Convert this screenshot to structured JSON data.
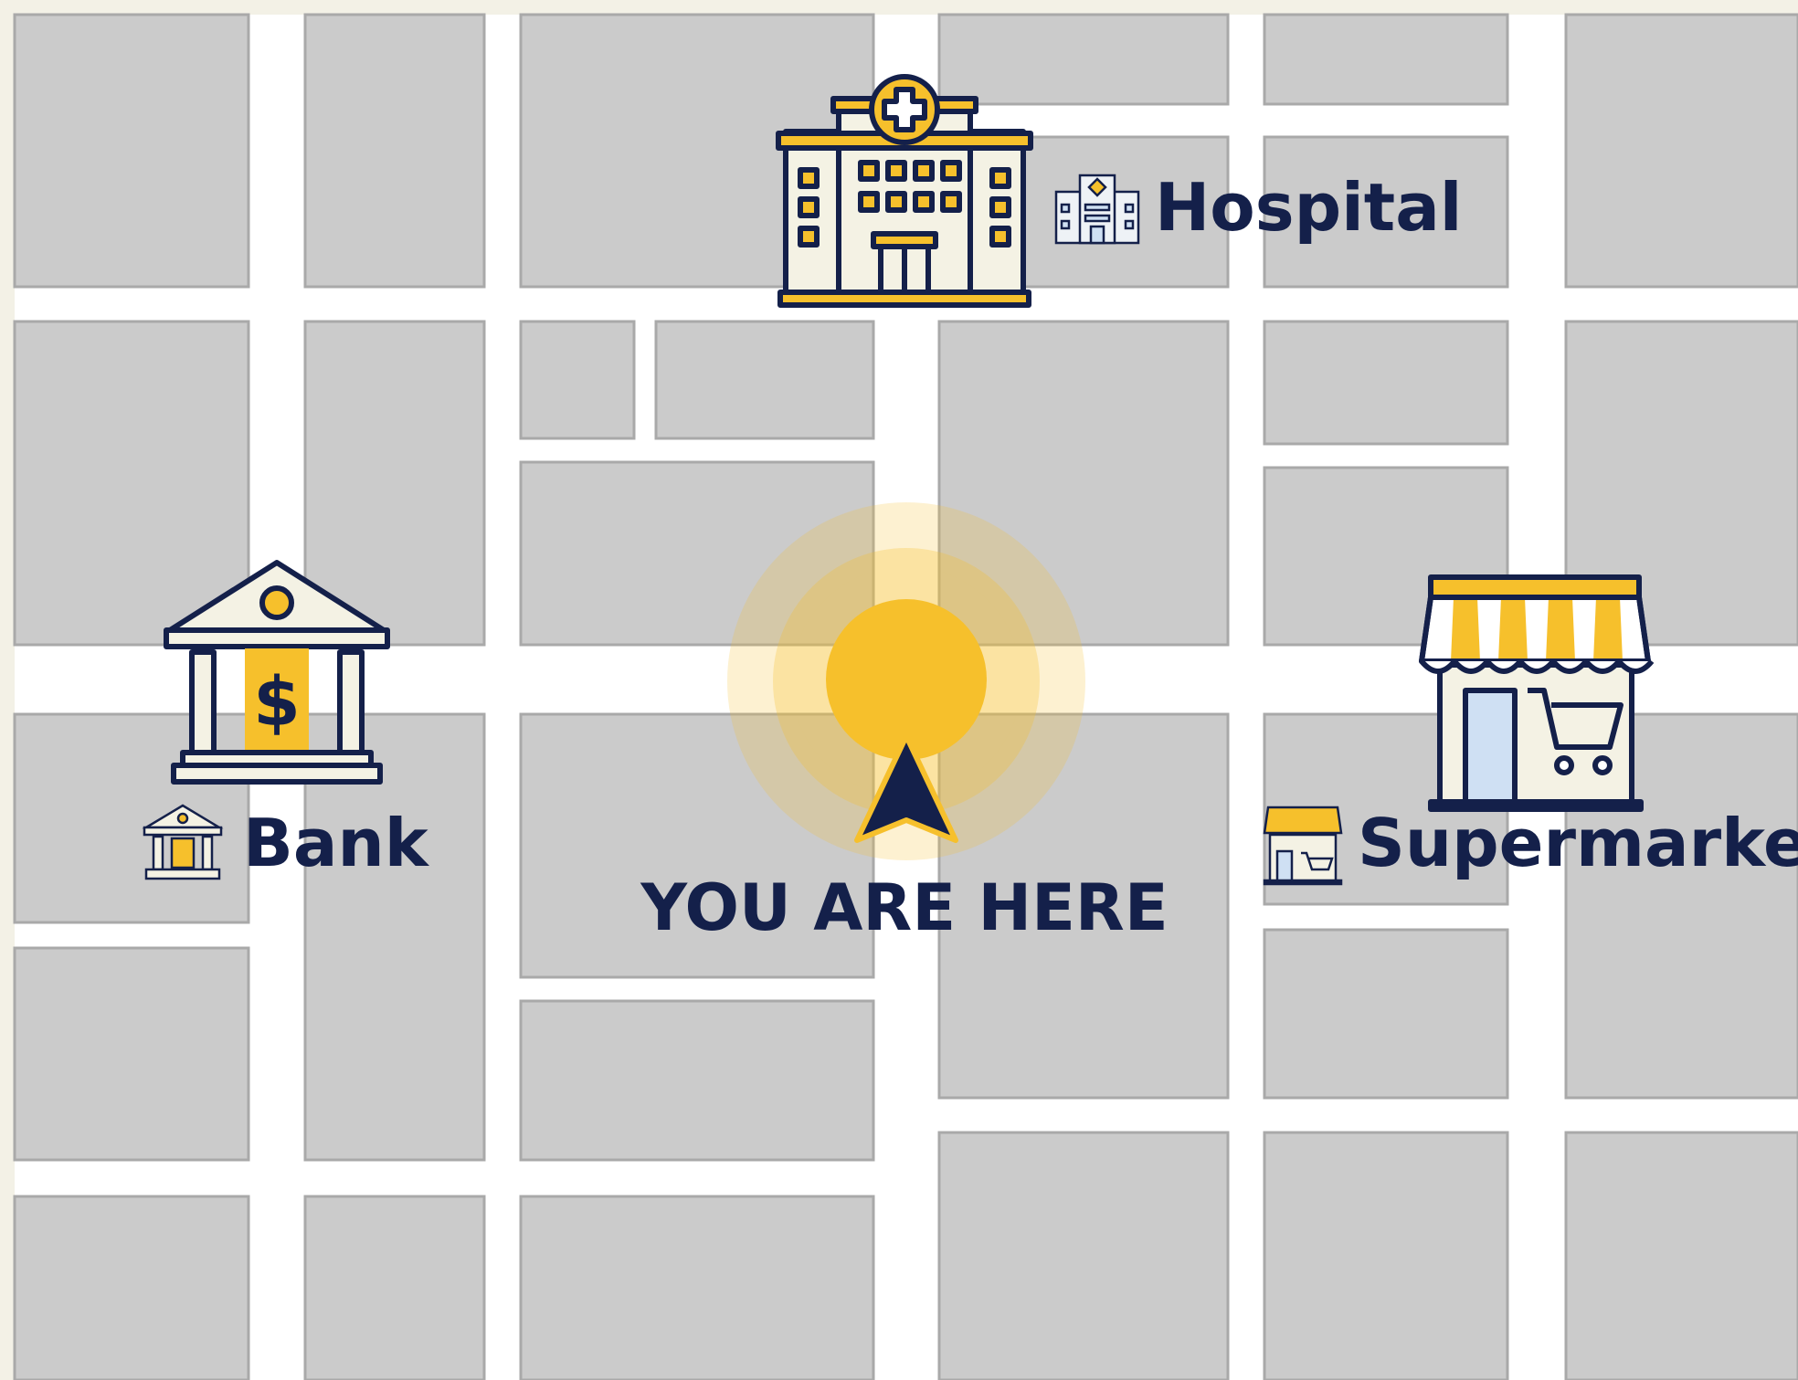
{
  "map": {
    "colors": {
      "background": "#f3f1e6",
      "street": "#ffffff",
      "block": "#cbcbcb",
      "block_edge": "#a9a9a9",
      "accent": "#f6c02c",
      "navy": "#14204a",
      "cream": "#f4f2e4",
      "door_blue": "#cfe0f3"
    },
    "places": {
      "hospital": {
        "label": "Hospital",
        "icon": "hospital-icon"
      },
      "bank": {
        "label": "Bank",
        "icon": "bank-icon"
      },
      "supermarket": {
        "label": "Supermarket",
        "icon": "supermarket-icon"
      }
    },
    "current_location": {
      "label": "YOU ARE HERE",
      "icon": "navigation-arrow-icon"
    }
  }
}
